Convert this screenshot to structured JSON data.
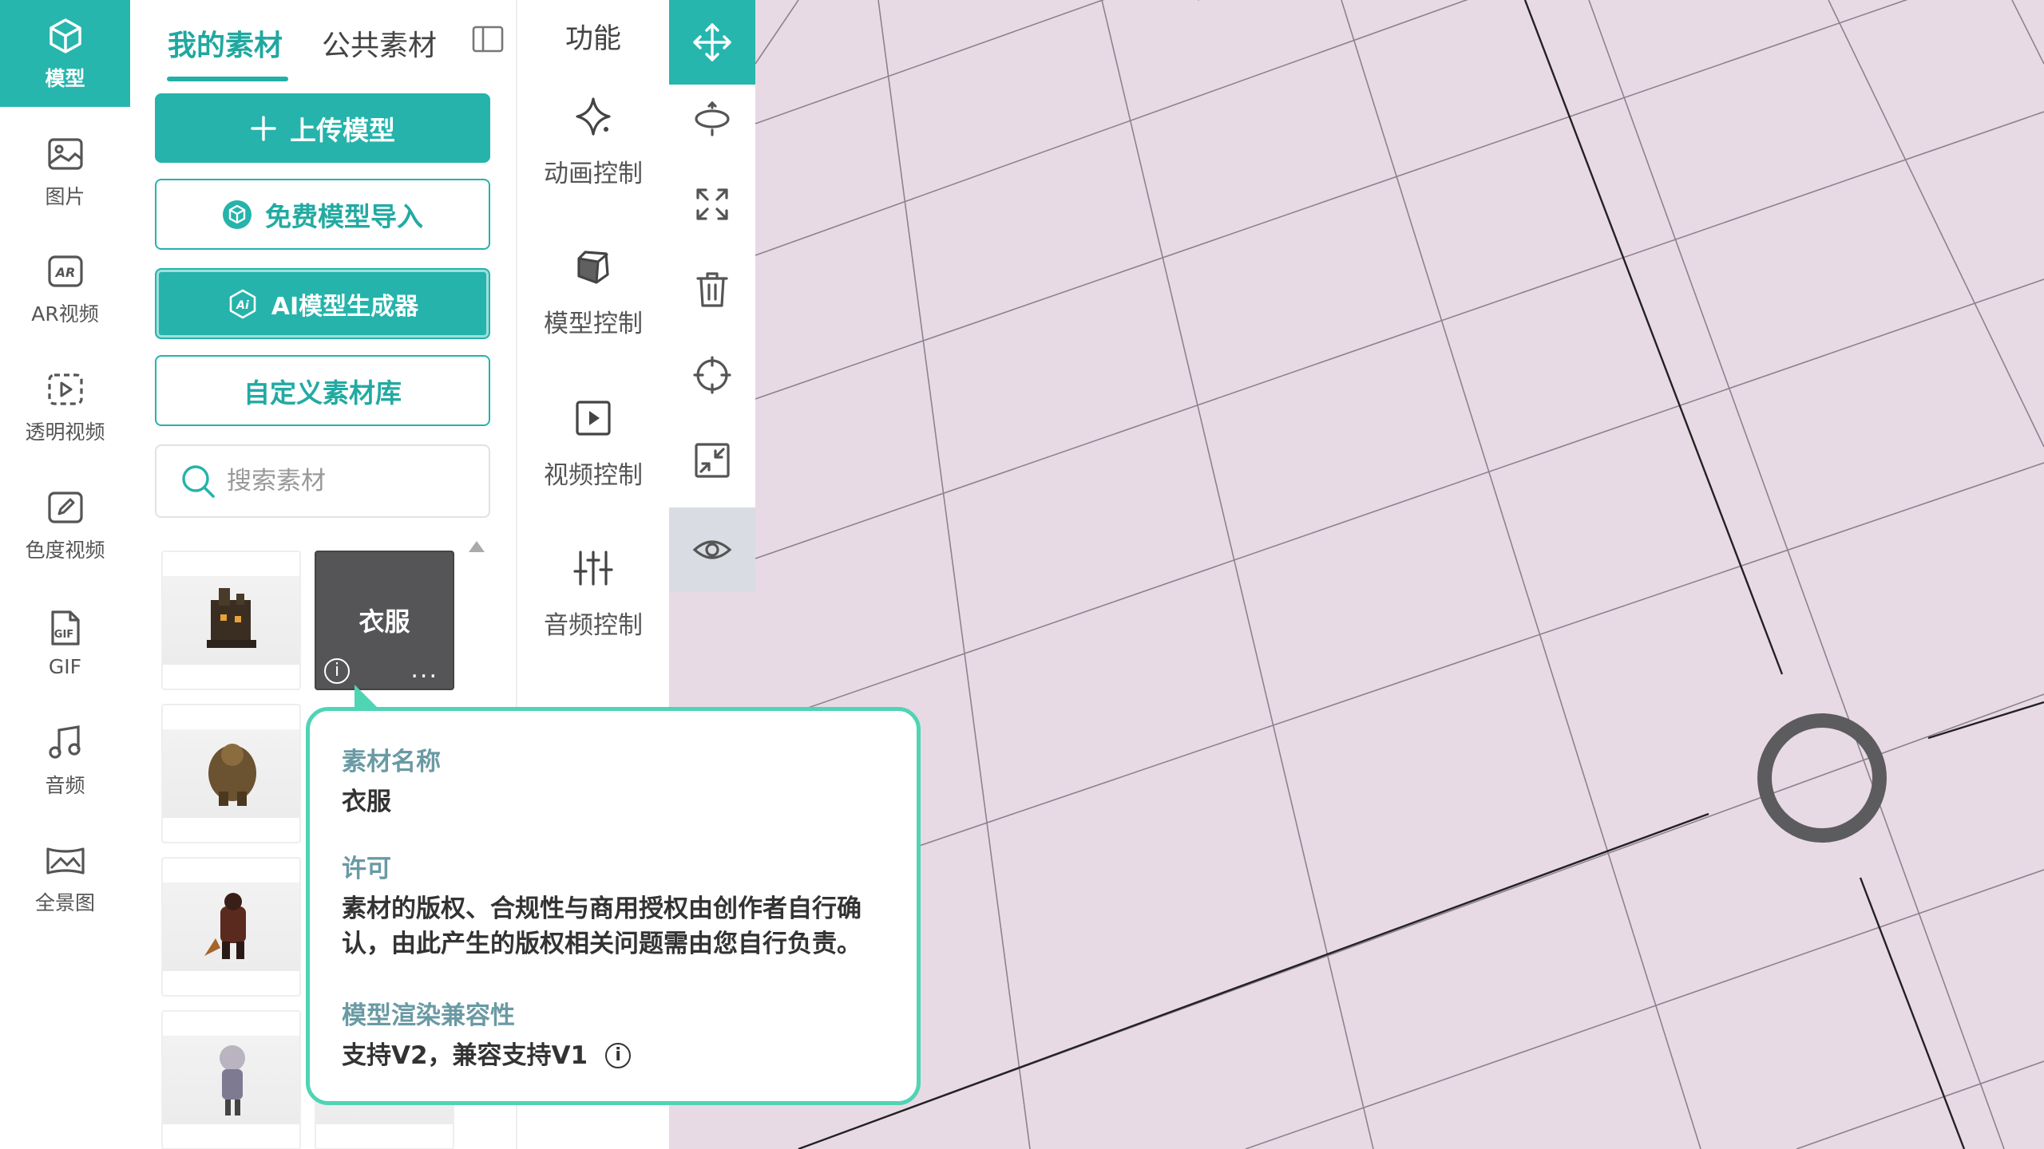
{
  "nav": {
    "items": [
      {
        "label": "模型",
        "icon": "cube-icon",
        "active": true
      },
      {
        "label": "图片",
        "icon": "image-icon"
      },
      {
        "label": "AR视频",
        "icon": "ar-icon"
      },
      {
        "label": "透明视频",
        "icon": "transparent-video-icon"
      },
      {
        "label": "色度视频",
        "icon": "chroma-video-icon"
      },
      {
        "label": "GIF",
        "icon": "gif-icon"
      },
      {
        "label": "音频",
        "icon": "music-icon"
      },
      {
        "label": "全景图",
        "icon": "panorama-icon"
      }
    ]
  },
  "panel": {
    "tab_mine": "我的素材",
    "tab_public": "公共素材",
    "upload_label": "上传模型",
    "import_label": "免费模型导入",
    "ai_label": "AI模型生成器",
    "custom_label": "自定义素材库",
    "search_placeholder": "搜索素材",
    "dark_thumb_label": "衣服",
    "info_glyph": "i",
    "more_glyph": "..."
  },
  "functions": {
    "title": "功能",
    "items": [
      {
        "label": "动画控制",
        "icon": "sparkle-icon"
      },
      {
        "label": "模型控制",
        "icon": "box-icon"
      },
      {
        "label": "视频控制",
        "icon": "play-icon"
      },
      {
        "label": "音频控制",
        "icon": "sliders-icon"
      }
    ]
  },
  "toolbar": {
    "tools": [
      "move-icon",
      "orbit-icon",
      "expand-icon",
      "trash-icon",
      "crosshair-icon",
      "shrink-icon",
      "eye-icon"
    ]
  },
  "popover": {
    "name_heading": "素材名称",
    "name_value": "衣服",
    "license_heading": "许可",
    "license_text": "素材的版权、合规性与商用授权由创作者自行确认，由此产生的版权相关问题需由您自行负责。",
    "compat_heading": "模型渲染兼容性",
    "compat_value": "支持V2，兼容支持V1",
    "compat_info": "i"
  },
  "colors": {
    "accent": "#26b6ae",
    "popover_border": "#4fd4b4",
    "viewport_bg": "#e8dae5"
  }
}
